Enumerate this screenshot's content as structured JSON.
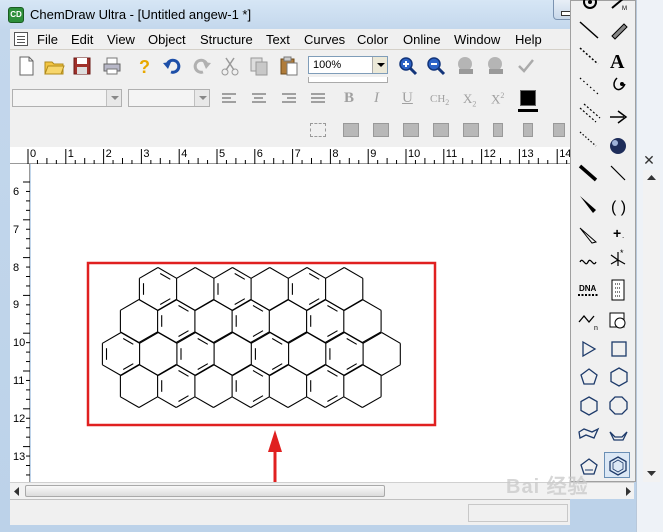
{
  "window": {
    "title": "ChemDraw Ultra - [Untitled angew-1 *]",
    "app_icon_label": "CD"
  },
  "menu": {
    "items": [
      "File",
      "Edit",
      "View",
      "Object",
      "Structure",
      "Text",
      "Curves",
      "Color",
      "Online",
      "Window",
      "Help"
    ]
  },
  "toolbar": {
    "zoom_value": "100%",
    "icons": [
      "new-doc-icon",
      "open-folder-icon",
      "save-icon",
      "print-icon",
      "help-icon",
      "undo-icon",
      "redo-icon",
      "cut-icon",
      "copy-icon",
      "paste-icon"
    ],
    "format_labels": {
      "bold": "B",
      "italic": "I",
      "underline": "U",
      "ch2": "CH",
      "ch2_sub": "2",
      "subscript": "X",
      "subscript_sub": "2",
      "superscript": "X",
      "superscript_sup": "2"
    },
    "color": "#000000"
  },
  "ruler": {
    "horizontal": [
      "0",
      "1",
      "2",
      "3",
      "4",
      "5",
      "6",
      "7",
      "8",
      "9",
      "10",
      "11",
      "12",
      "13",
      "14"
    ],
    "vertical": [
      "6",
      "7",
      "8",
      "9",
      "10",
      "11",
      "12",
      "13"
    ]
  },
  "palette": {
    "text_tool_label": "A",
    "dna_label": "DNA",
    "tools": [
      "lasso-icon",
      "eraser-icon",
      "bond-icon",
      "text-tool-icon",
      "dashed-bond-icon",
      "pen-icon",
      "hashed-bond-icon",
      "arrow-icon",
      "multi-bond-icon",
      "orbital-icon",
      "bold-bond-icon",
      "bracket-icon",
      "wedge-bond-icon",
      "charge-icon",
      "hashed-wedge-icon",
      "radical-icon",
      "wavy-bond-icon",
      "query-icon",
      "dna-tool-icon",
      "table-icon",
      "acyclic-chain-icon",
      "template-icon",
      "triangle-icon",
      "square-icon",
      "pentagon-icon",
      "hexagon-icon",
      "cyclohexane-chair-icon",
      "octagon-icon",
      "cyclohexane-chair2-icon",
      "benzene-ring-icon",
      "cyclopentadiene-icon",
      "benzene-selected-icon"
    ]
  },
  "highlight_color": "#e02020",
  "watermark_text": "Bai 经验"
}
